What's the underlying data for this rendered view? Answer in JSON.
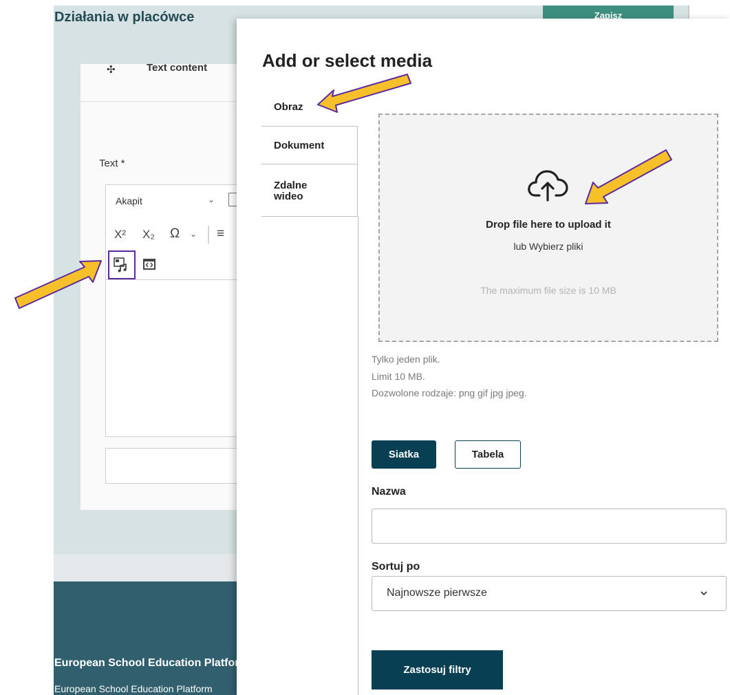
{
  "background_page": {
    "title": "Działania w placówce",
    "save_button": "Zapisz",
    "paragraph_header": "Text content",
    "field_label": "Text *",
    "editor": {
      "format_select": "Akapit",
      "superscript": "X²",
      "subscript": "X₂",
      "special_chars": "Ω",
      "align_icon": "≡"
    },
    "footer": {
      "title": "European School Education Platform",
      "subtitle": "European School Education Platform"
    }
  },
  "modal": {
    "title": "Add or select media",
    "tabs": [
      {
        "label": "Obraz"
      },
      {
        "label": "Dokument"
      },
      {
        "label": "Zdalne\nwideo"
      }
    ],
    "dropzone": {
      "main_text": "Drop file here to upload it",
      "or_text": "lub Wybierz pliki",
      "max_text": "The maximum file size is 10 MB"
    },
    "help": [
      "Tylko jeden plik.",
      "Limit 10 MB.",
      "Dozwolone rodzaje: png gif jpg jpeg."
    ],
    "view_buttons": {
      "grid": "Siatka",
      "table": "Tabela"
    },
    "name_filter": {
      "label": "Nazwa",
      "value": ""
    },
    "sort": {
      "label": "Sortuj po",
      "selected": "Najnowsze pierwsze"
    },
    "apply_button": "Zastosuj filtry"
  },
  "colors": {
    "primary_dark": "#093f53",
    "arrow_fill": "#f5c02a",
    "arrow_outline": "#5b2aa0",
    "footer": "#325f6e"
  }
}
